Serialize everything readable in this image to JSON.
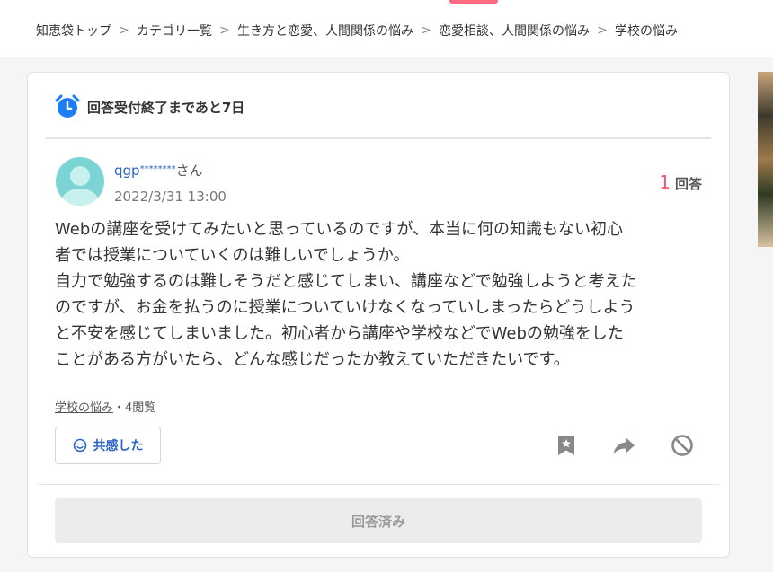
{
  "breadcrumb": {
    "items": [
      "知恵袋トップ",
      "カテゴリ一覧",
      "生き方と恋愛、人間関係の悩み",
      "恋愛相談、人間関係の悩み",
      "学校の悩み"
    ],
    "separator": ">"
  },
  "deadline": {
    "icon": "alarm-clock-icon",
    "text": "回答受付終了まであと7日"
  },
  "question": {
    "author": {
      "name": "qgp",
      "mask": "********",
      "suffix": "さん"
    },
    "date": "2022/3/31 13:00",
    "answer_count": "1",
    "answer_label": "回答",
    "body_lines": [
      "Webの講座を受けてみたいと思っているのですが、本当に何の知識もない初心",
      "者では授業についていくのは難しいでしょうか。",
      "自力で勉強するのは難しそうだと感じてしまい、講座などで勉強しようと考えた",
      "のですが、お金を払うのに授業についていけなくなっていしまったらどうしよう",
      "と不安を感じてしまいました。初心者から講座や学校などでWebの勉強をした",
      "ことがある方がいたら、どんな感じだったか教えていただきたいです。"
    ],
    "category": "学校の悩み",
    "views": "・4閲覧"
  },
  "actions": {
    "empathy_label": "共感した",
    "empathy_icon": "smile-icon",
    "bookmark_icon": "bookmark-icon",
    "share_icon": "share-icon",
    "block_icon": "block-icon"
  },
  "answered_button": {
    "label": "回答済み"
  },
  "colors": {
    "accent_pink": "#f2576d",
    "link_blue": "#2a64c5",
    "clock_blue": "#1c7ef5",
    "icon_gray": "#888888"
  }
}
